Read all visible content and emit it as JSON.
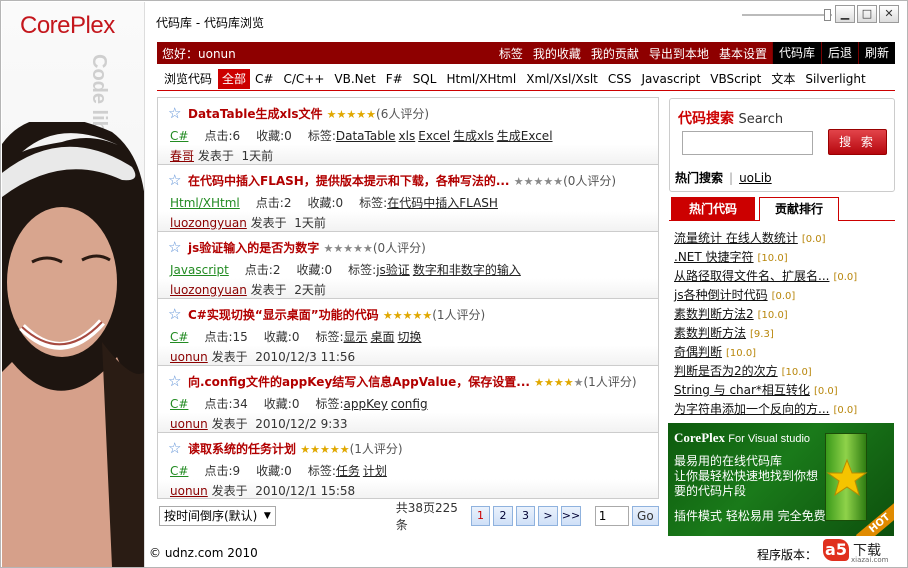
{
  "app": {
    "logo_part1": "Core",
    "logo_part2": "Plex",
    "vertical_text": "Code library Online and useful",
    "title": "代码库 - 代码库浏览"
  },
  "window_controls": {
    "minimize": "▁",
    "maximize": "□",
    "close": "✕"
  },
  "topbar": {
    "hello": "您好：uonun",
    "links": [
      "标签",
      "我的收藏",
      "我的贡献",
      "导出到本地",
      "基本设置"
    ],
    "dark_links": [
      "代码库",
      "后退",
      "刷新"
    ]
  },
  "langbar": {
    "label": "浏览代码",
    "tabs": [
      "全部",
      "C#",
      "C/C++",
      "VB.Net",
      "F#",
      "SQL",
      "Html/XHtml",
      "Xml/Xsl/Xslt",
      "CSS",
      "Javascript",
      "VBScript",
      "文本",
      "Silverlight"
    ],
    "active_index": 0
  },
  "labels": {
    "clicks": "点击:",
    "favs": "收藏:",
    "tags": "标签:",
    "posted": "发表于"
  },
  "items": [
    {
      "title": "DataTable生成xls文件",
      "rating_stars": 5,
      "rating_text": "(6人评分)",
      "lang": "C#",
      "clicks": "6",
      "favs": "0",
      "tags": [
        "DataTable",
        "xls",
        "Excel",
        "生成xls",
        "生成Excel"
      ],
      "author": "春哥",
      "time": "1天前"
    },
    {
      "title": "在代码中插入FLASH，提供版本提示和下载，各种写法的...",
      "rating_stars": 0,
      "rating_text": "(0人评分)",
      "lang": "Html/XHtml",
      "clicks": "2",
      "favs": "0",
      "tags": [
        "在代码中插入FLASH"
      ],
      "author": "luozongyuan",
      "time": "1天前"
    },
    {
      "title": "js验证输入的是否为数字",
      "rating_stars": 0,
      "rating_text": "(0人评分)",
      "lang": "Javascript",
      "clicks": "2",
      "favs": "0",
      "tags": [
        "js验证",
        "数字和非数字的输入"
      ],
      "author": "luozongyuan",
      "time": "2天前"
    },
    {
      "title": "C#实现切换“显示桌面”功能的代码",
      "rating_stars": 5,
      "rating_text": "(1人评分)",
      "lang": "C#",
      "clicks": "15",
      "favs": "0",
      "tags": [
        "显示",
        "桌面",
        "切换"
      ],
      "author": "uonun",
      "time": "2010/12/3 11:56"
    },
    {
      "title": "向.config文件的appKey结写入信息AppValue，保存设置...",
      "rating_stars": 4,
      "rating_text": "(1人评分)",
      "lang": "C#",
      "clicks": "34",
      "favs": "0",
      "tags": [
        "appKey",
        "config"
      ],
      "author": "uonun",
      "time": "2010/12/2 9:33"
    },
    {
      "title": "读取系统的任务计划",
      "rating_stars": 5,
      "rating_text": "(1人评分)",
      "lang": "C#",
      "clicks": "9",
      "favs": "0",
      "tags": [
        "任务",
        "计划"
      ],
      "author": "uonun",
      "time": "2010/12/1 15:58"
    }
  ],
  "pager": {
    "sort": "按时间倒序(默认)",
    "summary": "共38页225条",
    "pages": [
      "1",
      "2",
      "3",
      ">",
      ">>"
    ],
    "current": "1",
    "input": "1",
    "go": "Go"
  },
  "search": {
    "title_cn": "代码搜索",
    "title_en": "Search",
    "button": "搜 索",
    "placeholder": "",
    "hot_label": "热门搜索",
    "hot_term": "uoLib"
  },
  "hot": {
    "tabs": [
      "热门代码",
      "贡献排行"
    ],
    "items": [
      {
        "t": "流量统计 在线人数统计",
        "s": "[0.0]"
      },
      {
        "t": ".NET 快捷字符",
        "s": "[10.0]"
      },
      {
        "t": "从路径取得文件名、扩展名...",
        "s": "[0.0]"
      },
      {
        "t": "js各种倒计时代码",
        "s": "[0.0]"
      },
      {
        "t": "素数判断方法2",
        "s": "[10.0]"
      },
      {
        "t": "素数判断方法",
        "s": "[9.3]"
      },
      {
        "t": "奇偶判断",
        "s": "[10.0]"
      },
      {
        "t": "判断是否为2的次方",
        "s": "[10.0]"
      },
      {
        "t": "String 与 char*相互转化",
        "s": "[0.0]"
      },
      {
        "t": "为字符串添加一个反向的方...",
        "s": "[0.0]"
      }
    ]
  },
  "ad": {
    "brand": "CorePlex",
    "sub": "For Visual studio",
    "line1": "最易用的在线代码库",
    "line2": "让你最轻松快速地找到你想",
    "line3": "要的代码片段",
    "features": "插件模式  轻松易用  完全免费",
    "badge": "HOT"
  },
  "footer": {
    "copyright": "© udnz.com 2010",
    "version_label": "程序版本："
  },
  "watermark": {
    "logo": "a5",
    "text": "下载",
    "url": "xiazai.com"
  }
}
